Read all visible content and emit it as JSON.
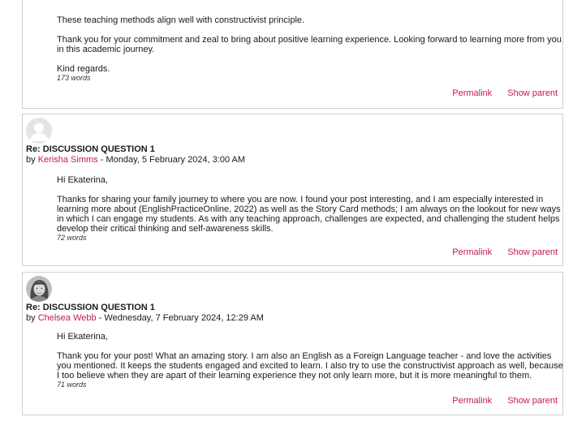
{
  "posts": [
    {
      "paragraphs": [
        "These teaching methods align well with constructivist principle.",
        "Thank you for your commitment and zeal to bring about positive learning experience. Looking forward to learning more from you in this academic journey.",
        "Kind regards."
      ],
      "word_count": "173 words",
      "actions": {
        "permalink": "Permalink",
        "show_parent": "Show parent"
      }
    },
    {
      "avatar": "default-user-icon",
      "subject": "Re: DISCUSSION QUESTION 1",
      "by": "by",
      "author": "Kerisha Simms",
      "date": "- Monday, 5 February 2024, 3:00 AM",
      "paragraphs": [
        "Hi Ekaterina,",
        "Thanks for sharing your family journey to where you are now. I found your post interesting, and I am especially interested in learning more about (EnglishPracticeOnline, 2022) as well as the Story Card methods; I am always on the lookout for new ways in which I can engage my students. As with any teaching approach, challenges are expected, and challenging the student helps develop their critical thinking and self-awareness skills."
      ],
      "word_count": "72 words",
      "actions": {
        "permalink": "Permalink",
        "show_parent": "Show parent"
      }
    },
    {
      "avatar": "user-photo",
      "subject": "Re: DISCUSSION QUESTION 1",
      "by": "by",
      "author": "Chelsea Webb",
      "date": "- Wednesday, 7 February 2024, 12:29 AM",
      "paragraphs": [
        "Hi Ekaterina,",
        "Thank you for your post! What an amazing story. I am also an English as a Foreign Language teacher - and love the activities you mentioned. It keeps the students engaged and excited to learn. I also try to use the constructivist approach as well, because I too believe when they are apart of their learning experience they not only learn more, but it is more meaningful to them."
      ],
      "word_count": "71 words",
      "actions": {
        "permalink": "Permalink",
        "show_parent": "Show parent"
      }
    }
  ],
  "colors": {
    "link": "#c2185b",
    "border": "#cfcfcf",
    "text": "#1a1a1a"
  }
}
